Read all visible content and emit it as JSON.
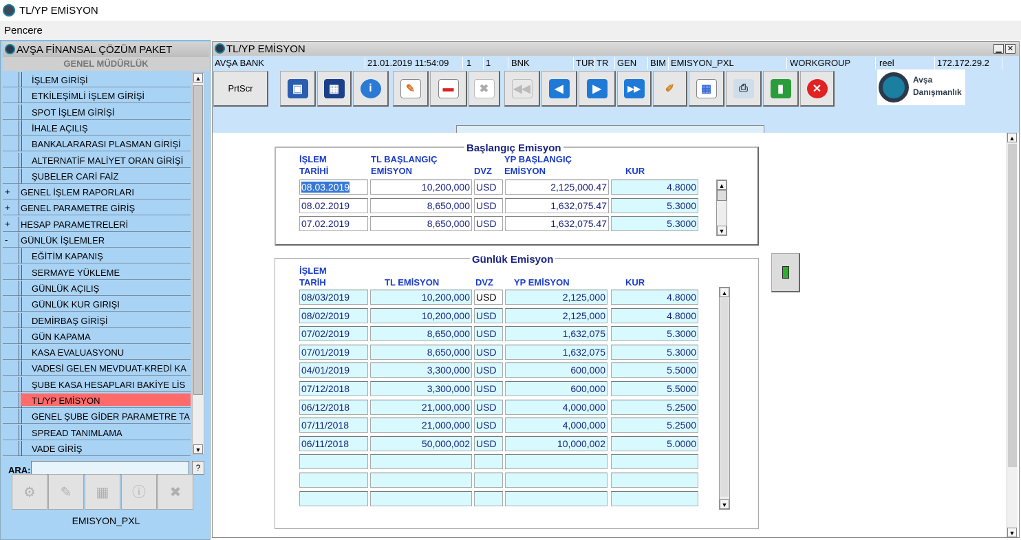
{
  "window": {
    "title": "TL/YP EMİSYON"
  },
  "menu": {
    "pencere": "Pencere"
  },
  "left_panel": {
    "title": "AVŞA FİNANSAL ÇÖZÜM PAKET",
    "subtitle": "GENEL MÜDÜRLÜK",
    "items": [
      {
        "label": "İŞLEM GİRİŞİ",
        "level": 2,
        "exp": ""
      },
      {
        "label": "ETKİLEŞİMLİ İŞLEM GİRİŞİ",
        "level": 2,
        "exp": ""
      },
      {
        "label": "SPOT İŞLEM GİRİŞİ",
        "level": 2,
        "exp": ""
      },
      {
        "label": "İHALE AÇILIŞ",
        "level": 2,
        "exp": ""
      },
      {
        "label": "BANKALARARASI PLASMAN GİRİŞİ",
        "level": 2,
        "exp": ""
      },
      {
        "label": "ALTERNATİF MALİYET ORAN GİRİŞİ",
        "level": 2,
        "exp": ""
      },
      {
        "label": "ŞUBELER CARİ FAİZ",
        "level": 2,
        "exp": ""
      },
      {
        "label": "GENEL İŞLEM RAPORLARI",
        "level": 1,
        "exp": "+"
      },
      {
        "label": "GENEL PARAMETRE GİRİŞ",
        "level": 1,
        "exp": "+"
      },
      {
        "label": "HESAP PARAMETRELERİ",
        "level": 1,
        "exp": "+"
      },
      {
        "label": "GÜNLÜK İŞLEMLER",
        "level": 1,
        "exp": "-"
      },
      {
        "label": "EĞİTİM KAPANIŞ",
        "level": 2,
        "exp": ""
      },
      {
        "label": "SERMAYE YÜKLEME",
        "level": 2,
        "exp": ""
      },
      {
        "label": "GÜNLÜK AÇILIŞ",
        "level": 2,
        "exp": ""
      },
      {
        "label": "GÜNLÜK KUR GIRIŞI",
        "level": 2,
        "exp": ""
      },
      {
        "label": "DEMİRBAŞ GİRİŞİ",
        "level": 2,
        "exp": ""
      },
      {
        "label": "GÜN KAPAMA",
        "level": 2,
        "exp": ""
      },
      {
        "label": "KASA EVALUASYONU",
        "level": 2,
        "exp": ""
      },
      {
        "label": "VADESİ GELEN MEVDUAT-KREDİ KA",
        "level": 2,
        "exp": ""
      },
      {
        "label": "ŞUBE KASA HESAPLARI BAKİYE LİS",
        "level": 2,
        "exp": ""
      },
      {
        "label": "TL/YP EMİSYON",
        "level": 2,
        "exp": "",
        "selected": true
      },
      {
        "label": "GENEL ŞUBE GİDER PARAMETRE TA",
        "level": 2,
        "exp": ""
      },
      {
        "label": "SPREAD TANIMLAMA",
        "level": 2,
        "exp": ""
      },
      {
        "label": "VADE GİRİŞ",
        "level": 2,
        "exp": ""
      }
    ],
    "search_label": "ARA:",
    "search_value": "",
    "help": "?",
    "footer": "EMISYON_PXL"
  },
  "main": {
    "title": "TL/YP EMİSYON",
    "info": {
      "bank": "AVŞA BANK",
      "datetime": "21.01.2019 11:54:09",
      "f1": "1",
      "f2": "1",
      "f3": "BNK",
      "f4": "TUR",
      "f5": "TR",
      "f6": "GEN",
      "f7": "BIM",
      "f8": "EMISYON_PXL",
      "f9": "WORKGROUP",
      "f10": "reel",
      "ip": "172.172.29.2"
    },
    "prtscr": "PrtScr",
    "logo": {
      "line1": "Avşa",
      "line2": "Danışmanlık"
    },
    "status_text": ""
  },
  "baslangic": {
    "title": "Başlangıç Emisyon",
    "headers": {
      "tarih1": "İŞLEM",
      "tarih2": "TARİHİ",
      "tl1": "TL BAŞLANGIÇ",
      "tl2": "EMİSYON",
      "dvz": "DVZ",
      "yp1": "YP BAŞLANGIÇ",
      "yp2": "EMİSYON",
      "kur": "KUR"
    },
    "rows": [
      {
        "tarih": "08.03.2019",
        "tl": "10,200,000",
        "dvz": "USD",
        "yp": "2,125,000.47",
        "kur": "4.8000"
      },
      {
        "tarih": "08.02.2019",
        "tl": "8,650,000",
        "dvz": "USD",
        "yp": "1,632,075.47",
        "kur": "5.3000"
      },
      {
        "tarih": "07.02.2019",
        "tl": "8,650,000",
        "dvz": "USD",
        "yp": "1,632,075.47",
        "kur": "5.3000"
      }
    ]
  },
  "gunluk": {
    "title": "Günlük Emisyon",
    "headers": {
      "tarih1": "İŞLEM",
      "tarih2": "TARİH",
      "tl": "TL EMİSYON",
      "dvz": "DVZ",
      "yp": "YP EMİSYON",
      "kur": "KUR"
    },
    "rows": [
      {
        "tarih": "08/03/2019",
        "tl": "10,200,000",
        "dvz": "USD",
        "yp": "2,125,000",
        "kur": "4.8000"
      },
      {
        "tarih": "08/02/2019",
        "tl": "10,200,000",
        "dvz": "USD",
        "yp": "2,125,000",
        "kur": "4.8000"
      },
      {
        "tarih": "07/02/2019",
        "tl": "8,650,000",
        "dvz": "USD",
        "yp": "1,632,075",
        "kur": "5.3000"
      },
      {
        "tarih": "07/01/2019",
        "tl": "8,650,000",
        "dvz": "USD",
        "yp": "1,632,075",
        "kur": "5.3000"
      },
      {
        "tarih": "04/01/2019",
        "tl": "3,300,000",
        "dvz": "USD",
        "yp": "600,000",
        "kur": "5.5000"
      },
      {
        "tarih": "07/12/2018",
        "tl": "3,300,000",
        "dvz": "USD",
        "yp": "600,000",
        "kur": "5.5000"
      },
      {
        "tarih": "06/12/2018",
        "tl": "21,000,000",
        "dvz": "USD",
        "yp": "4,000,000",
        "kur": "5.2500"
      },
      {
        "tarih": "07/11/2018",
        "tl": "21,000,000",
        "dvz": "USD",
        "yp": "4,000,000",
        "kur": "5.2500"
      },
      {
        "tarih": "06/11/2018",
        "tl": "50,000,002",
        "dvz": "USD",
        "yp": "10,000,002",
        "kur": "5.0000"
      },
      {
        "tarih": "",
        "tl": "",
        "dvz": "",
        "yp": "",
        "kur": ""
      },
      {
        "tarih": "",
        "tl": "",
        "dvz": "",
        "yp": "",
        "kur": ""
      },
      {
        "tarih": "",
        "tl": "",
        "dvz": "",
        "yp": "",
        "kur": ""
      }
    ]
  }
}
